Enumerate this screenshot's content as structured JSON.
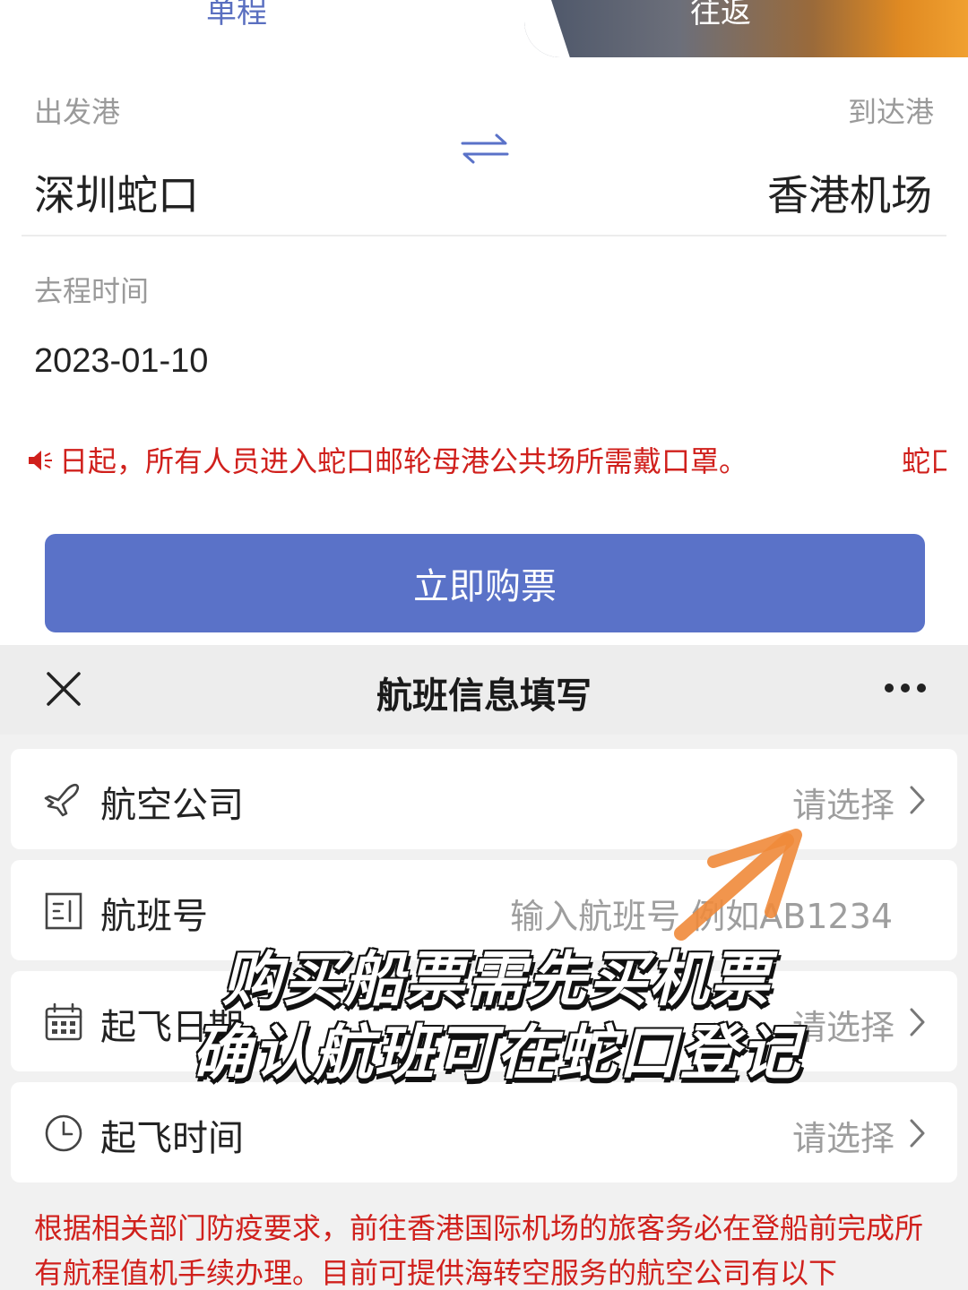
{
  "tabs": {
    "oneway": "单程",
    "roundtrip": "往返"
  },
  "route": {
    "depart_label": "出发港",
    "arrive_label": "到达港",
    "depart_port": "深圳蛇口",
    "arrive_port": "香港机场"
  },
  "date": {
    "label": "去程时间",
    "value": "2023-01-10"
  },
  "notice": {
    "text": "日起，所有人员进入蛇口邮轮母港公共场所需戴口罩。",
    "text_repeat": "蛇口"
  },
  "buy_button": "立即购票",
  "sheet": {
    "title": "航班信息填写",
    "rows": [
      {
        "label": "航空公司",
        "value": "请选择",
        "icon": "airplane-icon"
      },
      {
        "label": "航班号",
        "value": "输入航班号 例如AB1234",
        "icon": "flight-number-icon"
      },
      {
        "label": "起飞日期",
        "value": "请选择",
        "icon": "calendar-icon"
      },
      {
        "label": "起飞时间",
        "value": "请选择",
        "icon": "clock-icon"
      }
    ],
    "footer_note": "根据相关部门防疫要求，前往香港国际机场的旅客务必在登船前完成所有航程值机手续办理。目前可提供海转空服务的航空公司有以下"
  },
  "overlay": {
    "caption_line1": "购买船票需先买机票",
    "caption_line2": "确认航班可在蛇口登记"
  },
  "colors": {
    "accent": "#5a72c8",
    "warning": "#d0201c",
    "annotation_arrow": "#f08a3a"
  }
}
